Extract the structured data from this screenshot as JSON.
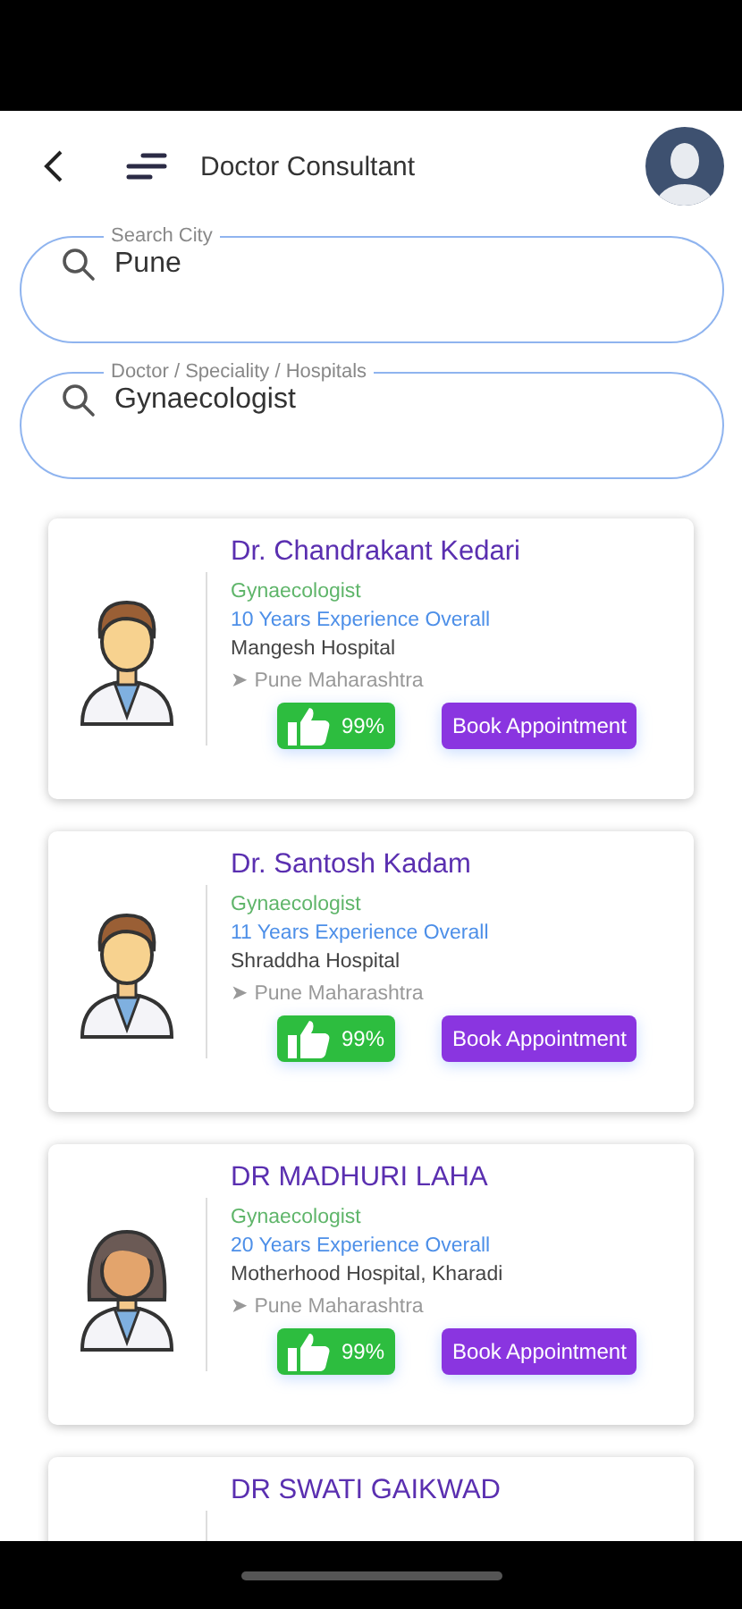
{
  "header": {
    "title": "Doctor Consultant"
  },
  "search_fields": [
    {
      "label": "Search City",
      "value": "Pune"
    },
    {
      "label": "Doctor / Speciality / Hospitals",
      "value": "Gynaecologist"
    }
  ],
  "doctors": [
    {
      "name": "Dr. Chandrakant Kedari",
      "kind": "male",
      "speciality": "Gynaecologist",
      "experience": "10 Years Experience Overall",
      "hospital": "Mangesh Hospital",
      "location": "➤ Pune Maharashtra",
      "rating": "99%",
      "action": "Book Appointment"
    },
    {
      "name": "Dr. Santosh Kadam",
      "kind": "male",
      "speciality": "Gynaecologist",
      "experience": "11 Years Experience Overall",
      "hospital": "Shraddha Hospital",
      "location": "➤ Pune Maharashtra",
      "rating": "99%",
      "action": "Book Appointment"
    },
    {
      "name": "DR MADHURI LAHA",
      "kind": "female",
      "speciality": "Gynaecologist",
      "experience": "20 Years Experience Overall",
      "hospital": "Motherhood Hospital, Kharadi",
      "location": "➤ Pune Maharashtra",
      "rating": "99%",
      "action": "Book Appointment"
    },
    {
      "name": "DR SWATI GAIKWAD"
    }
  ]
}
